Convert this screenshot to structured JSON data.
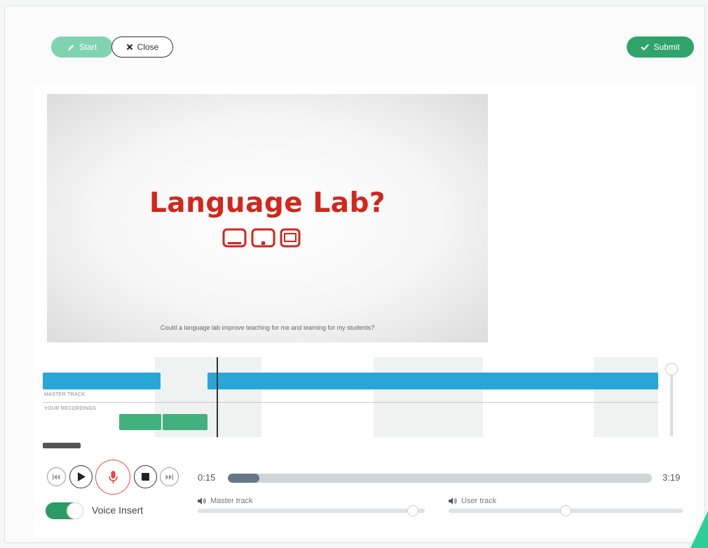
{
  "toolbar": {
    "start_label": "Start",
    "close_label": "Close",
    "submit_label": "Submit"
  },
  "video": {
    "title": "Language Lab?",
    "caption": "Could a language lab improve teaching for me and learning for my students?"
  },
  "timeline": {
    "master_track_label": "MASTER TRACK",
    "recordings_label": "YOUR RECORDINGS"
  },
  "player": {
    "current_time": "0:15",
    "total_time": "3:19",
    "progress_fraction": 0.075,
    "voice_insert_label": "Voice Insert",
    "voice_insert_on": true,
    "master_track_label": "Master track",
    "user_track_label": "User track",
    "master_volume_fraction": 0.97,
    "user_volume_fraction": 0.5
  },
  "colors": {
    "accent_green": "#2fa36b",
    "record_red": "#e24a42",
    "track_blue": "#29a6d8",
    "title_red": "#d4261c"
  },
  "icons": [
    "pencil-icon",
    "x-icon",
    "check-icon",
    "skip-back-icon",
    "play-icon",
    "microphone-icon",
    "stop-icon",
    "skip-forward-icon",
    "speaker-icon"
  ]
}
